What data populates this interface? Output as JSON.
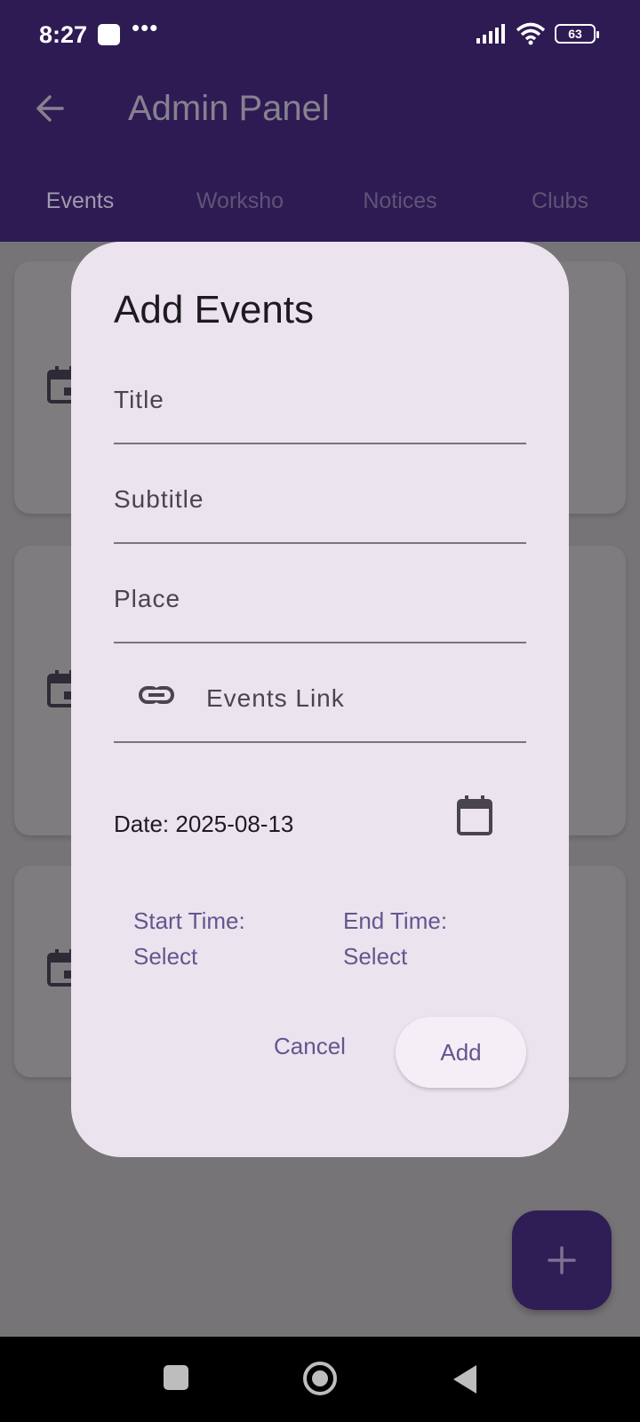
{
  "status_bar": {
    "time": "8:27",
    "dots": "•••",
    "battery": "63"
  },
  "app_bar": {
    "title": "Admin Panel"
  },
  "tabs": [
    {
      "label": "Events"
    },
    {
      "label": "Worksho"
    },
    {
      "label": "Notices"
    },
    {
      "label": "Clubs"
    }
  ],
  "dialog": {
    "title": "Add Events",
    "fields": {
      "title_placeholder": "Title",
      "subtitle_placeholder": "Subtitle",
      "place_placeholder": "Place",
      "link_placeholder": "Events Link"
    },
    "date_text": "Date: 2025-08-13",
    "start_time": {
      "label": "Start Time:",
      "value": "Select"
    },
    "end_time": {
      "label": "End Time:",
      "value": "Select"
    },
    "cancel_label": "Cancel",
    "add_label": "Add"
  },
  "colors": {
    "app_bar": "#2e1b54",
    "dialog_bg": "#ebe4ee",
    "accent": "#65558f"
  },
  "icons": {
    "back": "arrow-left-icon",
    "calendar": "calendar-icon",
    "link": "link-icon",
    "fab": "plus-icon"
  }
}
